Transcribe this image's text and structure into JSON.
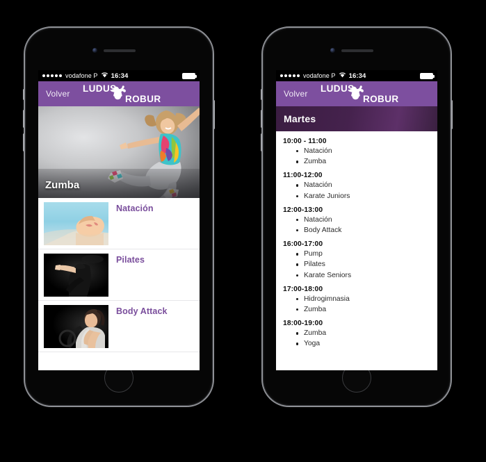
{
  "meta": {
    "background_color": "#000000",
    "accent_purple": "#7d4f9f",
    "link_purple": "#7a4e9c",
    "daybar_purple": "#3b1d42"
  },
  "status_bar": {
    "signal_dots": 5,
    "carrier": "vodafone P",
    "wifi_icon": "wifi-icon",
    "time": "16:34",
    "battery_icon": "battery-full-icon"
  },
  "navbar": {
    "back_label": "Volver",
    "logo_top": "LUDUS",
    "logo_bottom": "ROBUR",
    "logo_mark_icon": "flexing-muscle-icon"
  },
  "phone_left": {
    "hero": {
      "label": "Zumba",
      "image_alt": "zumba-dancer-photo"
    },
    "list": [
      {
        "title": "Natación",
        "thumb": "swimmer-photo"
      },
      {
        "title": "Pilates",
        "thumb": "pilates-photo"
      },
      {
        "title": "Body Attack",
        "thumb": "body-attack-photo"
      }
    ]
  },
  "phone_right": {
    "day": "Martes",
    "schedule": [
      {
        "time": "10:00 - 11:00",
        "classes": [
          "Natación",
          "Zumba"
        ]
      },
      {
        "time": "11:00-12:00",
        "classes": [
          "Natación",
          "Karate Juniors"
        ]
      },
      {
        "time": "12:00-13:00",
        "classes": [
          "Natación",
          "Body Attack"
        ]
      },
      {
        "time": "16:00-17:00",
        "classes": [
          "Pump",
          "Pilates",
          "Karate Seniors"
        ]
      },
      {
        "time": "17:00-18:00",
        "classes": [
          "Hidrogimnasia",
          "Zumba"
        ]
      },
      {
        "time": "18:00-19:00",
        "classes": [
          "Zumba",
          "Yoga"
        ]
      }
    ]
  }
}
